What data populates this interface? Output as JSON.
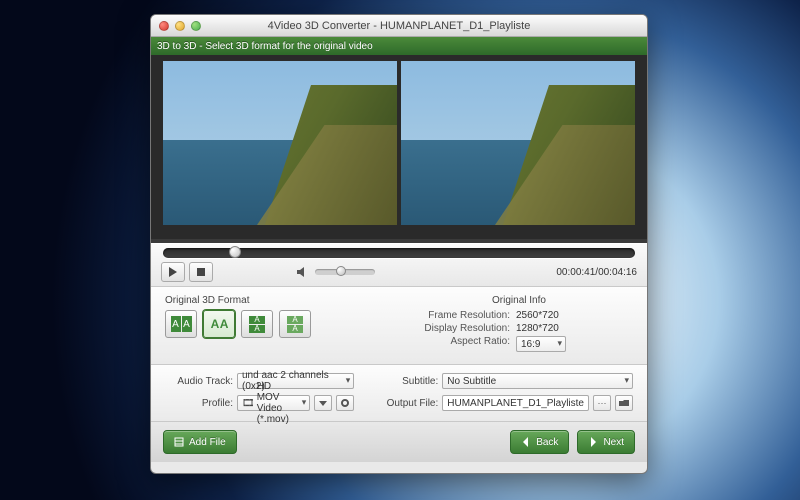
{
  "window": {
    "title": "4Video 3D Converter - HUMANPLANET_D1_Playliste"
  },
  "greenbar": {
    "text": "3D to 3D - Select 3D format for the original video"
  },
  "playback": {
    "time": "00:00:41/00:04:16"
  },
  "format": {
    "heading": "Original 3D Format"
  },
  "info": {
    "heading": "Original Info",
    "frame_res_label": "Frame Resolution:",
    "frame_res_value": "2560*720",
    "disp_res_label": "Display Resolution:",
    "disp_res_value": "1280*720",
    "aspect_label": "Aspect Ratio:",
    "aspect_value": "16:9"
  },
  "fields": {
    "audio_track_label": "Audio Track:",
    "audio_track_value": "und aac 2 channels (0x2)",
    "profile_label": "Profile:",
    "profile_value": "HD MOV Video (*.mov)",
    "subtitle_label": "Subtitle:",
    "subtitle_value": "No Subtitle",
    "output_label": "Output File:",
    "output_value": "HUMANPLANET_D1_Playliste"
  },
  "footer": {
    "add_file": "Add File",
    "back": "Back",
    "next": "Next"
  }
}
